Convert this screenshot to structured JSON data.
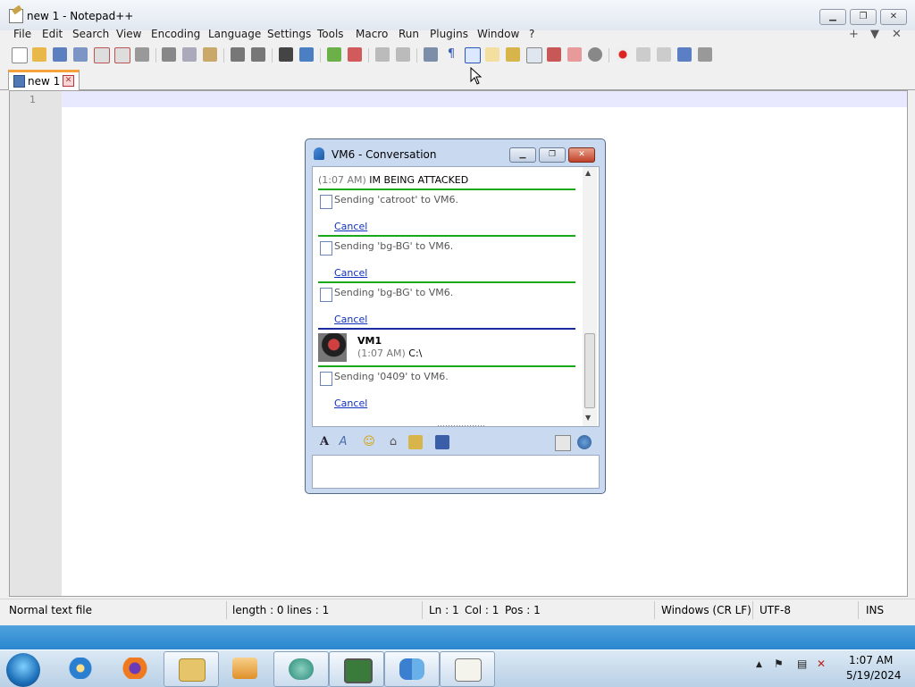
{
  "notepad": {
    "title": "new 1 - Notepad++",
    "menu": [
      "File",
      "Edit",
      "Search",
      "View",
      "Encoding",
      "Language",
      "Settings",
      "Tools",
      "Macro",
      "Run",
      "Plugins",
      "Window",
      "?"
    ],
    "menu_right": [
      "+",
      "▼",
      "✕"
    ],
    "tab": {
      "label": "new 1"
    },
    "editor": {
      "line_number": "1"
    },
    "status": {
      "file_type": "Normal text file",
      "length": "length : 0",
      "lines": "lines : 1",
      "ln": "Ln : 1",
      "col": "Col : 1",
      "pos": "Pos : 1",
      "eol": "Windows (CR LF)",
      "encoding": "UTF-8",
      "mode": "INS"
    }
  },
  "conversation": {
    "title": "VM6 - Conversation",
    "messages": {
      "first": {
        "time": "(1:07 AM)",
        "text": "IM BEING ATTACKED"
      },
      "transfers": [
        {
          "text": "Sending 'catroot' to VM6.",
          "cancel": "Cancel"
        },
        {
          "text": "Sending 'bg-BG' to VM6.",
          "cancel": "Cancel"
        },
        {
          "text": "Sending 'bg-BG' to VM6.",
          "cancel": "Cancel"
        }
      ],
      "vm1": {
        "name": "VM1",
        "time": "(1:07 AM)",
        "text": "C:\\"
      },
      "last": {
        "text": "Sending '0409' to VM6.",
        "cancel": "Cancel"
      }
    }
  },
  "taskbar": {
    "clock_time": "1:07 AM",
    "clock_date": "5/19/2024"
  }
}
